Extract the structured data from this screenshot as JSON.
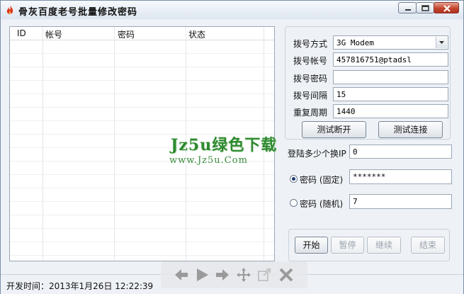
{
  "window": {
    "title": "骨灰百度老号批量修改密码",
    "colors": {
      "accent": "#1d3b6e",
      "watermark": "#2e8a2e",
      "close": "#c2452f"
    }
  },
  "list": {
    "columns": [
      "ID",
      "帐号",
      "密码",
      "状态"
    ],
    "rows": []
  },
  "dial": {
    "mode_label": "拨号方式",
    "mode_value": "3G Modem",
    "account_label": "拨号帐号",
    "account_value": "457816751@ptadsl",
    "password_label": "拨号密码",
    "password_value": "",
    "interval_label": "拨号间隔",
    "interval_value": "15",
    "period_label": "重复周期",
    "period_value": "1440",
    "test_disconnect": "测试断开",
    "test_connect": "测试连接"
  },
  "options": {
    "ip_label": "登陆多少个换IP",
    "ip_value": "0",
    "fixed_label": "密码 (固定)",
    "fixed_value": "*******",
    "random_label": "密码 (随机)",
    "random_value": "7",
    "selected": "fixed"
  },
  "actions": {
    "start": "开始",
    "pause": "暂停",
    "continue": "继续",
    "end": "结束"
  },
  "status": {
    "text": "开发时间：2013年1月26日  12:22:39"
  },
  "watermark": {
    "line1": "Jz5u绿色下载",
    "line2": "www.Jz5u.Com"
  },
  "icons": [
    "app-flame-icon",
    "minimize-icon",
    "maximize-icon",
    "close-icon",
    "arrow-left-icon",
    "play-icon",
    "arrow-right-icon",
    "move-icon",
    "external-link-icon",
    "close-x-icon",
    "dropdown-arrow-icon"
  ]
}
